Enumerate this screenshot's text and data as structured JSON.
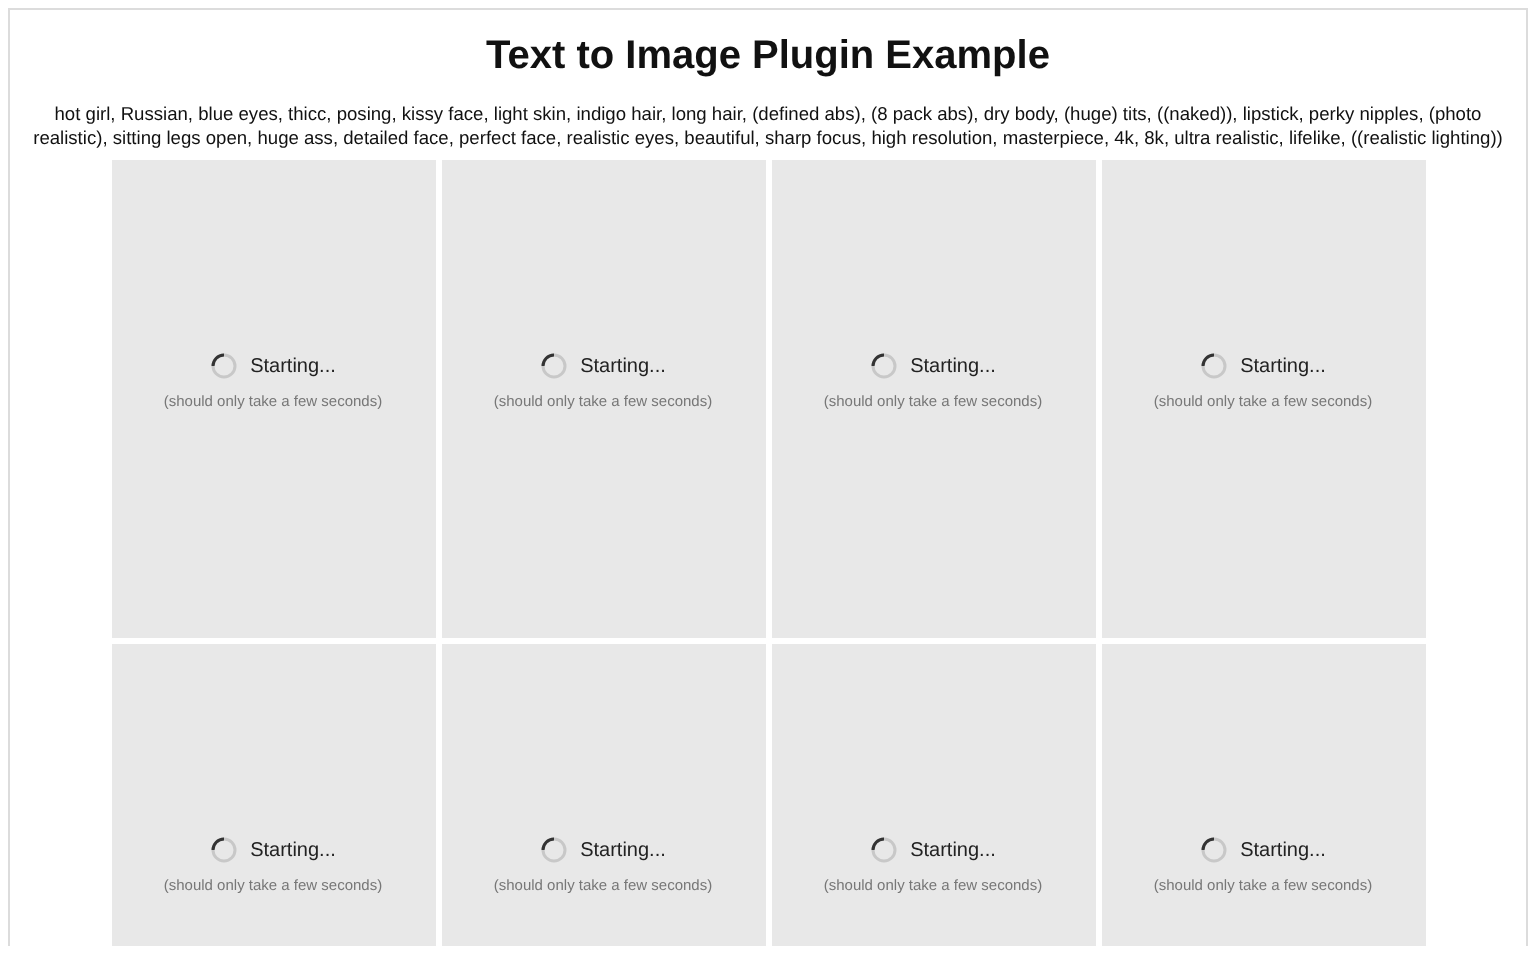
{
  "title": "Text to Image Plugin Example",
  "prompt": "hot girl, Russian, blue eyes, thicc, posing, kissy face, light skin, indigo hair, long hair, (defined abs), (8 pack abs), dry body, (huge) tits, ((naked)), lipstick, perky nipples, (photo realistic), sitting legs open, huge ass, detailed face, perfect face, realistic eyes, beautiful, sharp focus, high resolution, masterpiece, 4k, 8k, ultra realistic, lifelike, ((realistic lighting))",
  "tiles": [
    {
      "status": "Starting...",
      "note": "(should only take a few seconds)"
    },
    {
      "status": "Starting...",
      "note": "(should only take a few seconds)"
    },
    {
      "status": "Starting...",
      "note": "(should only take a few seconds)"
    },
    {
      "status": "Starting...",
      "note": "(should only take a few seconds)"
    },
    {
      "status": "Starting...",
      "note": "(should only take a few seconds)"
    },
    {
      "status": "Starting...",
      "note": "(should only take a few seconds)"
    },
    {
      "status": "Starting...",
      "note": "(should only take a few seconds)"
    },
    {
      "status": "Starting...",
      "note": "(should only take a few seconds)"
    }
  ]
}
